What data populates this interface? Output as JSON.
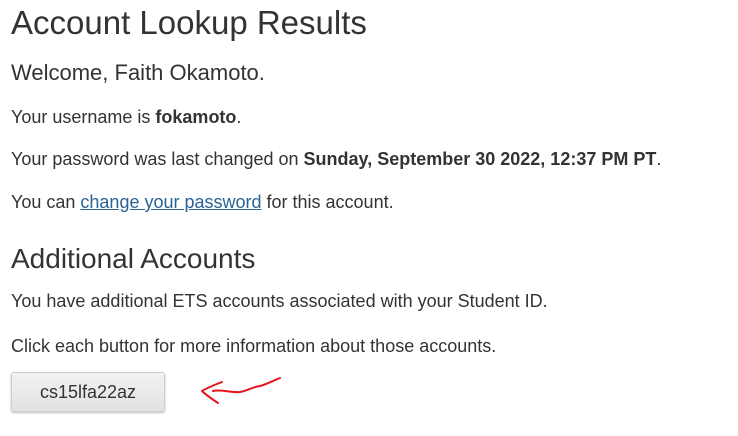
{
  "header": {
    "title": "Account Lookup Results"
  },
  "welcome": {
    "text": "Welcome, Faith Okamoto."
  },
  "username_line": {
    "prefix": "Your username is ",
    "username": "fokamoto",
    "suffix": "."
  },
  "password_line": {
    "prefix": "Your password was last changed on ",
    "changed_at": "Sunday, September 30 2022, 12:37 PM PT",
    "suffix": "."
  },
  "change_line": {
    "prefix": "You can ",
    "link_label": "change your password",
    "suffix": " for this account."
  },
  "additional": {
    "title": "Additional Accounts",
    "intro": "You have additional ETS accounts associated with your Student ID.",
    "instructions": "Click each button for more information about those accounts.",
    "accounts": [
      "cs15lfa22az"
    ]
  },
  "annotation": {
    "icon": "hand-drawn-arrow-icon",
    "color": "#e8141c"
  },
  "colors": {
    "text": "#333333",
    "link": "#2a6496"
  }
}
